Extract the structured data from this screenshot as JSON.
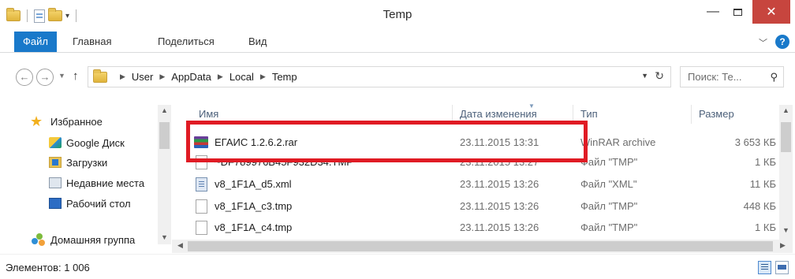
{
  "window": {
    "title": "Temp",
    "minimize_glyph": "—",
    "close_glyph": "✕"
  },
  "ribbon": {
    "tabs": [
      {
        "label": "Файл",
        "active": true
      },
      {
        "label": "Главная"
      },
      {
        "label": "Поделиться"
      },
      {
        "label": "Вид"
      }
    ],
    "help_glyph": "?",
    "accent_color": "#1979ca"
  },
  "address": {
    "crumbs": [
      "User",
      "AppData",
      "Local",
      "Temp"
    ],
    "search_placeholder": "Поиск: Те..."
  },
  "navigation": {
    "favorites_label": "Избранное",
    "items": [
      {
        "label": "Google Диск",
        "icon": "google-drive-icon"
      },
      {
        "label": "Загрузки",
        "icon": "downloads-folder-icon"
      },
      {
        "label": "Недавние места",
        "icon": "recent-places-icon"
      },
      {
        "label": "Рабочий стол",
        "icon": "desktop-icon"
      }
    ],
    "homegroup_label": "Домашняя группа"
  },
  "file_list": {
    "columns": {
      "name": "Имя",
      "date": "Дата изменения",
      "type": "Тип",
      "size": "Размер"
    },
    "rows": [
      {
        "name": "ЕГАИС 1.2.6.2.rar",
        "date": "23.11.2015 13:31",
        "type": "WinRAR archive",
        "size": "3 653 КБ",
        "icon": "winrar-archive-icon"
      },
      {
        "name": "~DF789976B45F932D34.TMP",
        "date": "23.11.2015 13:27",
        "type": "Файл \"TMP\"",
        "size": "1 КБ",
        "icon": "tmp-file-icon"
      },
      {
        "name": "v8_1F1A_d5.xml",
        "date": "23.11.2015 13:26",
        "type": "Файл \"XML\"",
        "size": "11 КБ",
        "icon": "xml-file-icon"
      },
      {
        "name": "v8_1F1A_c3.tmp",
        "date": "23.11.2015 13:26",
        "type": "Файл \"TMP\"",
        "size": "448 КБ",
        "icon": "tmp-file-icon"
      },
      {
        "name": "v8_1F1A_c4.tmp",
        "date": "23.11.2015 13:26",
        "type": "Файл \"TMP\"",
        "size": "1 КБ",
        "icon": "tmp-file-icon"
      }
    ],
    "highlight_color": "#e01b24"
  },
  "status": {
    "item_count": "Элементов: 1 006"
  }
}
